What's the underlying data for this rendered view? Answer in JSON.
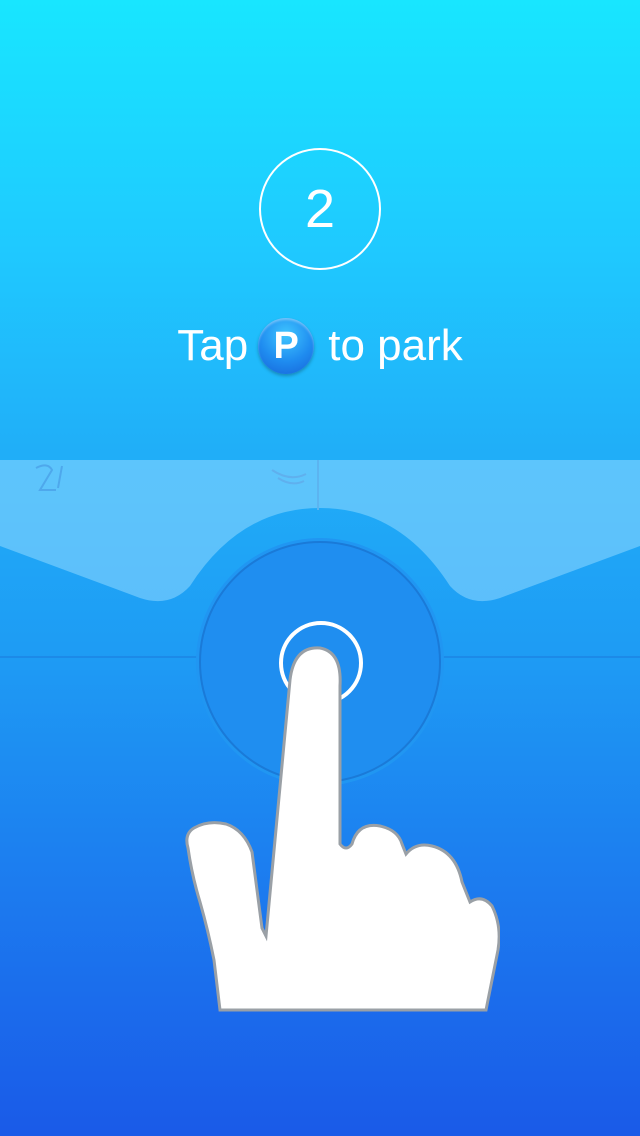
{
  "tutorial": {
    "step_number": "2",
    "text_before": "Tap",
    "badge_letter": "P",
    "text_after": "to park"
  },
  "colors": {
    "top": "#18e6ff",
    "bottom": "#1a5ae8",
    "text": "#ffffff",
    "badge": "#1f8cf0"
  },
  "icons": {
    "badge": "parking-p-icon",
    "hand": "tap-finger-hand-icon",
    "signal": "wifi-signal-icon"
  }
}
